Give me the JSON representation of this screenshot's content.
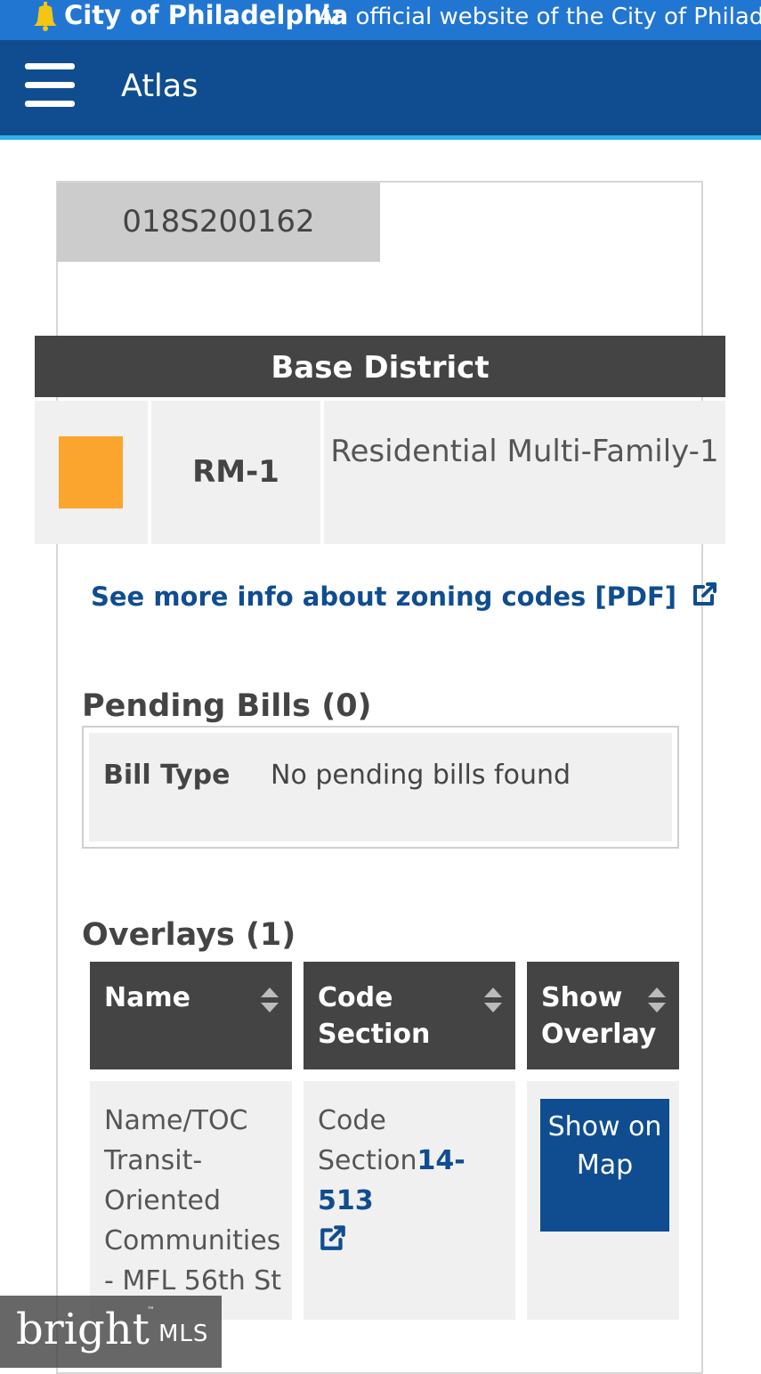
{
  "official_bar": {
    "city_name": "City of Philadelphia",
    "official_text": "An official website of the City of Philade"
  },
  "header": {
    "app_title": "Atlas",
    "menu_icon": "hamburger-menu-icon"
  },
  "parcel_tab": {
    "label": "018S200162"
  },
  "base_district": {
    "title": "Base District",
    "swatch_color": "#fba52e",
    "code": "RM-1",
    "description": "Residential Multi-Family-1"
  },
  "zoning_link": {
    "label": "See more info about zoning codes [PDF]",
    "icon": "external-link-icon"
  },
  "pending_bills": {
    "title": "Pending Bills (0)",
    "label": "Bill Type",
    "value": "No pending bills found"
  },
  "overlays": {
    "title": "Overlays (1)",
    "columns": [
      "Name",
      "Code Section",
      "Show Overlay"
    ],
    "rows": [
      {
        "name": "Name/TOC Transit-Oriented Communities - MFL 56th St",
        "code_prefix": "Code Section",
        "code_link": "14-513",
        "button": "Show on Map"
      }
    ]
  },
  "watermark": {
    "brand": "bright",
    "suffix": "MLS",
    "tm": "™"
  },
  "colors": {
    "official_bar": "#2176d2",
    "header": "#0f4d90",
    "header_accent": "#2fb3e8",
    "table_header": "#444444",
    "link": "#0f4d90"
  }
}
